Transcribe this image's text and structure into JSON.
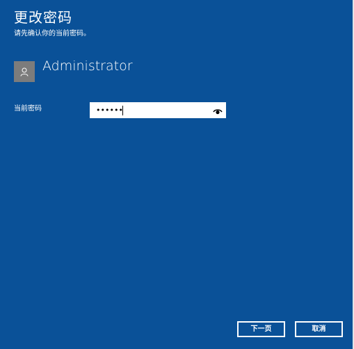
{
  "dialog": {
    "title": "更改密码",
    "subtitle": "请先确认你的当前密码。"
  },
  "user": {
    "name": "Administrator",
    "avatar_icon": "person-icon"
  },
  "password": {
    "label": "当前密码",
    "value_masked": "••••••",
    "reveal_icon": "eye-icon"
  },
  "buttons": {
    "next_label": "下一页",
    "cancel_label": "取消"
  },
  "colors": {
    "background": "#0a5198",
    "avatar": "#7c7c7c",
    "text": "#ffffff"
  }
}
